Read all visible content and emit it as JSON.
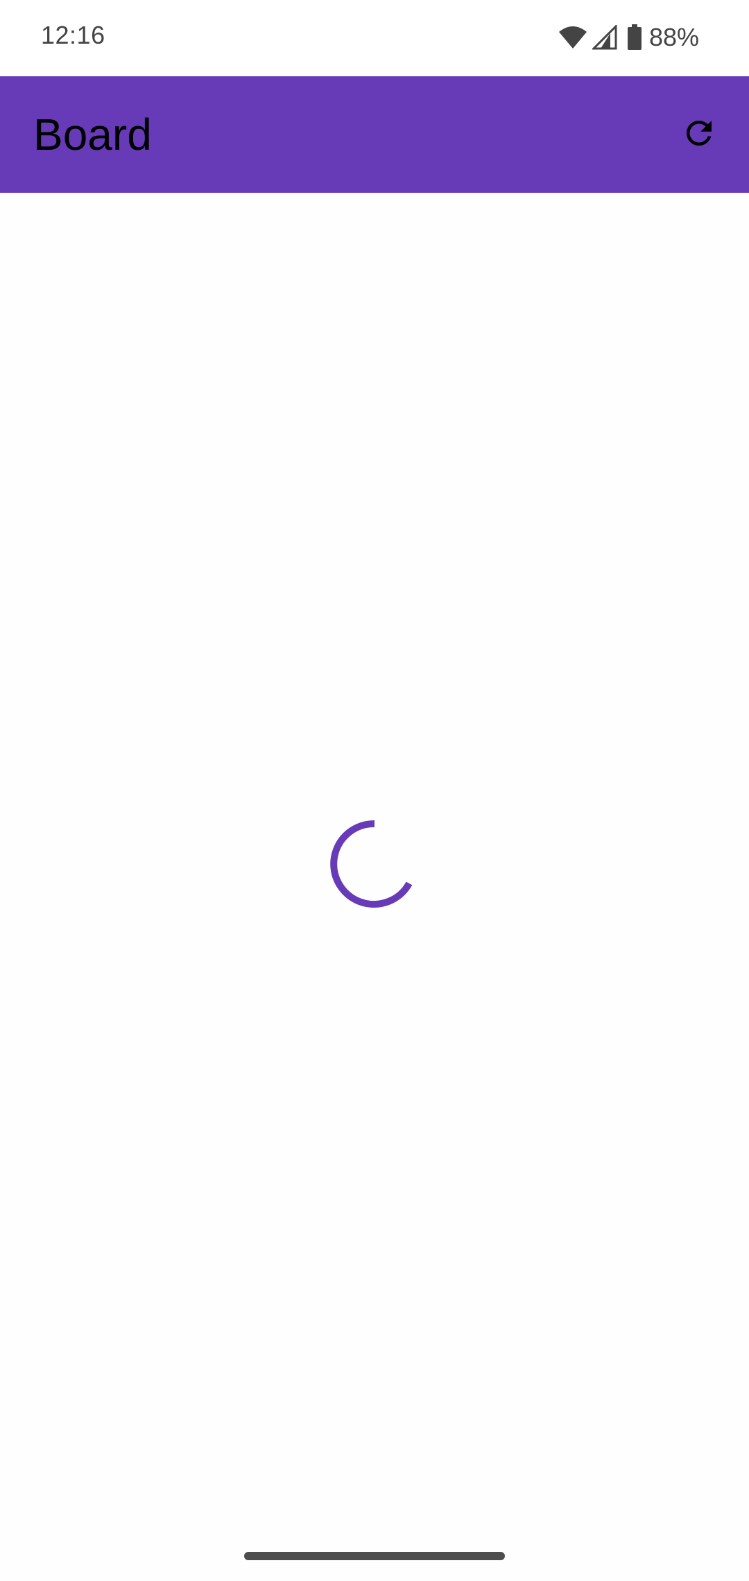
{
  "status_bar": {
    "time": "12:16",
    "battery_percent": "88%",
    "icons": [
      "wifi-icon",
      "cell-signal-icon",
      "battery-icon"
    ]
  },
  "app_bar": {
    "title": "Board",
    "refresh_icon": "refresh-icon",
    "background_color": "#673ab7"
  },
  "content": {
    "loading": true,
    "spinner_color": "#673ab7"
  },
  "navigation": {
    "gesture_handle": true
  }
}
